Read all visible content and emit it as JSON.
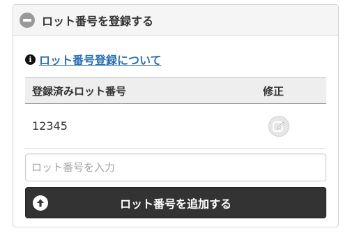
{
  "panel": {
    "title": "ロット番号を登録する",
    "collapse_icon": "minus-circle-icon"
  },
  "info": {
    "icon": "info-circle-icon",
    "link_text": "ロット番号登録について"
  },
  "table": {
    "columns": [
      "登録済みロット番号",
      "修正"
    ],
    "rows": [
      {
        "lot_number": "12345",
        "edit_icon": "edit-icon"
      }
    ]
  },
  "input": {
    "placeholder": "ロット番号を入力",
    "value": ""
  },
  "add_button": {
    "label": "ロット番号を追加する",
    "icon": "arrow-up-circle-icon"
  },
  "colors": {
    "accent_link": "#2a6fb4",
    "button_dark": "#333333",
    "header_bg": "#f5f5f5"
  }
}
